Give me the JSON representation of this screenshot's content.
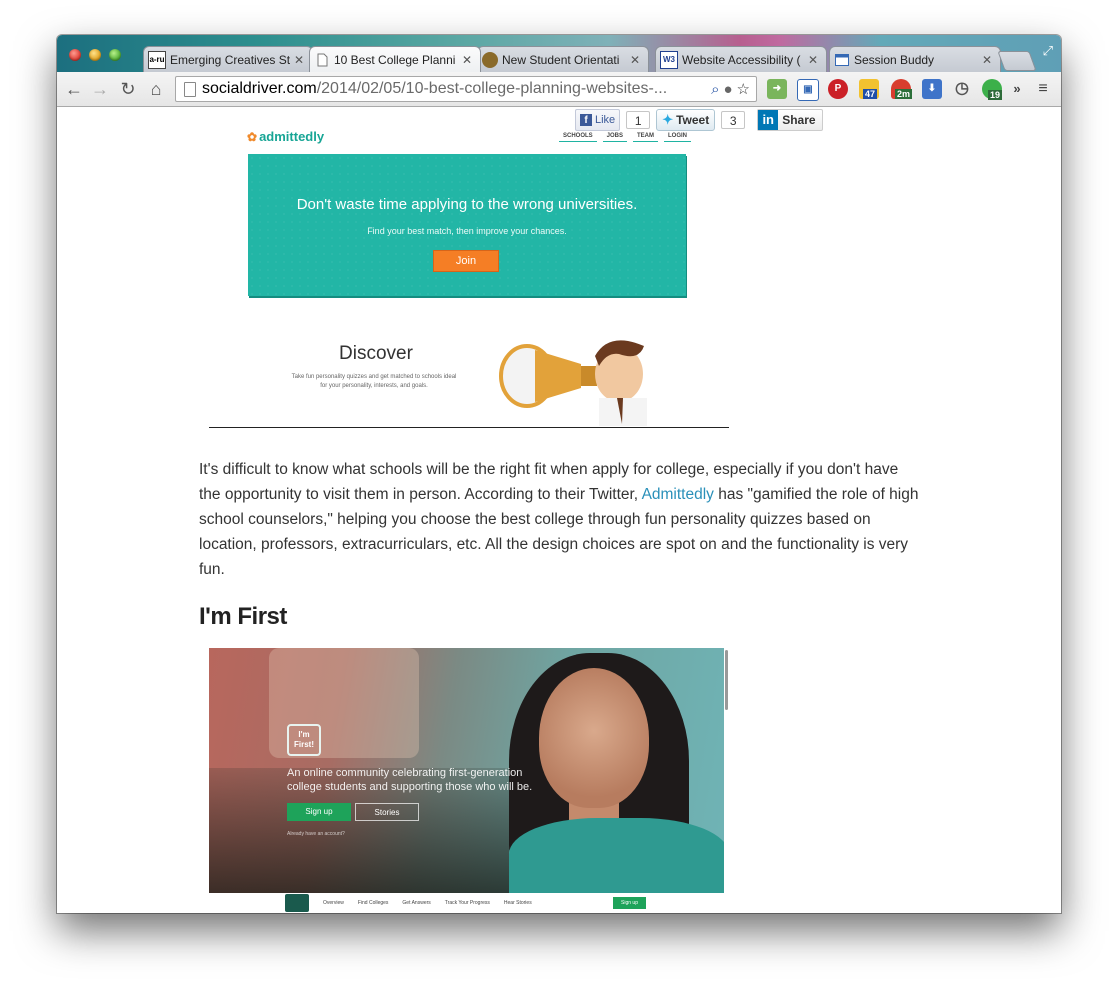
{
  "browser": {
    "tabs": [
      {
        "favicon": "a-ru",
        "title": "Emerging Creatives St",
        "active": false
      },
      {
        "favicon": "page-icon",
        "title": "10 Best College Planni",
        "active": true
      },
      {
        "favicon": "seal-icon",
        "title": "New Student Orientati",
        "active": false
      },
      {
        "favicon": "W3",
        "title": "Website Accessibility (",
        "active": false
      },
      {
        "favicon": "window-icon",
        "title": "Session Buddy",
        "active": false
      }
    ],
    "tab_close": "✕",
    "url_domain": "socialdriver.com",
    "url_path": "/2014/02/05/10-best-college-planning-websites-...",
    "extensions": {
      "weather_badge": "47",
      "timer_badge": "2m",
      "green_badge": "19",
      "overflow": "»"
    }
  },
  "share": {
    "fb_like": "Like",
    "fb_count": "1",
    "tweet": "Tweet",
    "tweet_count": "3",
    "linkedin": "Share"
  },
  "admittedly": {
    "logo": "admittedly",
    "nav": [
      "SCHOOLS",
      "JOBS",
      "TEAM",
      "LOGIN"
    ],
    "hero_title": "Don't waste time applying to the wrong universities.",
    "hero_sub": "Find your best match, then improve your chances.",
    "join": "Join",
    "discover": "Discover",
    "discover_sub": "Take fun personality quizzes and get matched to schools ideal for your personality, interests, and goals."
  },
  "article": {
    "p1_before": "It's difficult to know what schools will be the right fit when apply for college, especially if you don't have the opportunity to visit them in person. According to their Twitter, ",
    "p1_link": "Admittedly",
    "p1_after": " has \"gamified the role of high school counselors,\" helping you choose the best college through fun personality quizzes based on location, professors, extracurriculars, etc. All the design choices are spot on and the functionality is very fun.",
    "h2": "I'm First"
  },
  "imfirst": {
    "logo": "I'm First!",
    "tagline": "An online community celebrating first-generation college students and supporting those who will be.",
    "signup": "Sign up",
    "stories": "Stories",
    "already": "Already have an account?",
    "footer_links": [
      "Overview",
      "Find Colleges",
      "Get Answers",
      "Track Your Progress",
      "Hear Stories"
    ],
    "footer_signup": "Sign up"
  }
}
